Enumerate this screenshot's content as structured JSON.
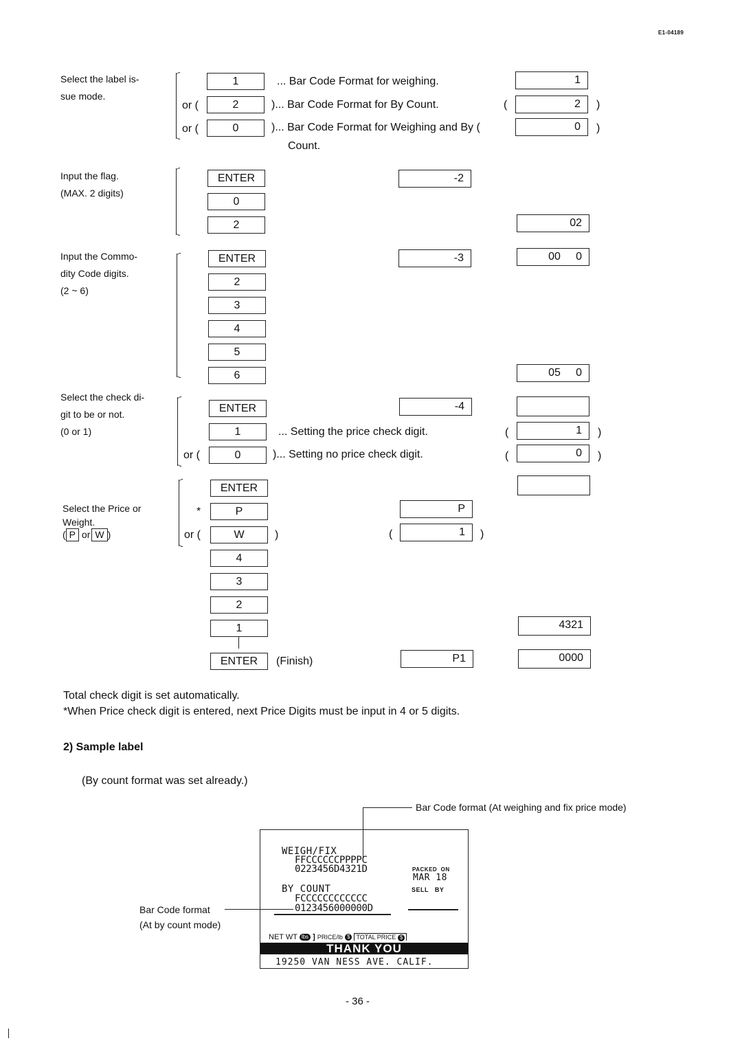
{
  "header": {
    "doc_id": "E1-04189"
  },
  "steps": {
    "label_mode": {
      "description": [
        "Select the label is-",
        "sue mode."
      ],
      "keys": [
        {
          "prefix": "",
          "key": "1",
          "suffix": "... Bar Code Format for weighing.",
          "display_prefix": "",
          "display": "1",
          "display_suffix": ""
        },
        {
          "prefix": "or (",
          "key": "2",
          "suffix": ")... Bar Code Format for By Count.",
          "display_prefix": "(",
          "display": "2",
          "display_suffix": ")"
        },
        {
          "prefix": "or (",
          "key": "0",
          "suffix": ")... Bar Code Format for Weighing and By (",
          "display_prefix": "",
          "display": "0",
          "display_suffix": ")"
        }
      ],
      "continuation": "Count."
    },
    "flag": {
      "description": [
        "Input the flag.",
        "(MAX. 2 digits)"
      ],
      "keys": [
        "ENTER",
        "0",
        "2"
      ],
      "display_mid": "-2",
      "display_right": "02"
    },
    "commodity": {
      "description": [
        "Input the Commo-",
        "dity Code digits.",
        "(2 ~ 6)"
      ],
      "keys": [
        "ENTER",
        "2",
        "3",
        "4",
        "5",
        "6"
      ],
      "display_mid": "-3",
      "display_right_first": "00     0",
      "display_right_last": "05     0"
    },
    "check_digit": {
      "description": [
        "Select the check di-",
        "git to be or not.",
        "(0 or 1)"
      ],
      "keys": [
        {
          "prefix": "",
          "key": "ENTER",
          "suffix": ""
        },
        {
          "prefix": "",
          "key": "1",
          "suffix": "... Setting the price check digit."
        },
        {
          "prefix": "or (",
          "key": "0",
          "suffix": ")... Setting no price check digit."
        }
      ],
      "display_mid": "-4",
      "display_right": [
        "",
        "1",
        "0"
      ]
    },
    "price_weight": {
      "description": [
        "Select the Price or",
        "Weight."
      ],
      "hint": {
        "open": "(",
        "p": "P",
        "or": "or",
        "w": "W",
        "close": ")"
      },
      "keys": [
        "ENTER",
        "P",
        "W",
        "4",
        "3",
        "2",
        "1",
        "ENTER"
      ],
      "marker": "*",
      "or_prefix": "or (",
      "w_suffix": ")",
      "finish": "(Finish)",
      "display_mid": [
        "P",
        "1",
        "P1"
      ],
      "display_right": [
        "",
        "4321",
        "0000"
      ],
      "paren_open": "(",
      "paren_close": ")"
    }
  },
  "notes": {
    "line1": "Total check digit is set automatically.",
    "line2": "*When Price check digit is entered, next Price Digits must be input in 4 or 5 digits."
  },
  "sample": {
    "heading": "2)  Sample label",
    "subnote": "(By count format was set already.)",
    "callout_top": "Bar Code format (At weighing and fix price mode)",
    "callout_left": [
      "Bar Code format",
      "(At by count mode)"
    ],
    "label": {
      "weigh_title": "WEIGH/FIX",
      "weigh_format": "FFCCCCCCPPPPC",
      "weigh_example": "0223456D4321D",
      "count_title": "BY COUNT",
      "count_format": "FCCCCCCCCCCCC",
      "count_example": "0123456000000D",
      "packed_on": "PACKED  ON",
      "date": "MAR 18",
      "sell_by": "SELL   BY",
      "net_wt": "NET WT",
      "lbs": "lbs",
      "price_lb": "PRICE/lb",
      "total_price": "TOTAL PRICE",
      "dollar": "$",
      "thank_you": "THANK YOU",
      "address": "19250 VAN NESS AVE. CALIF."
    }
  },
  "footer": {
    "page_number": "- 36 -"
  }
}
